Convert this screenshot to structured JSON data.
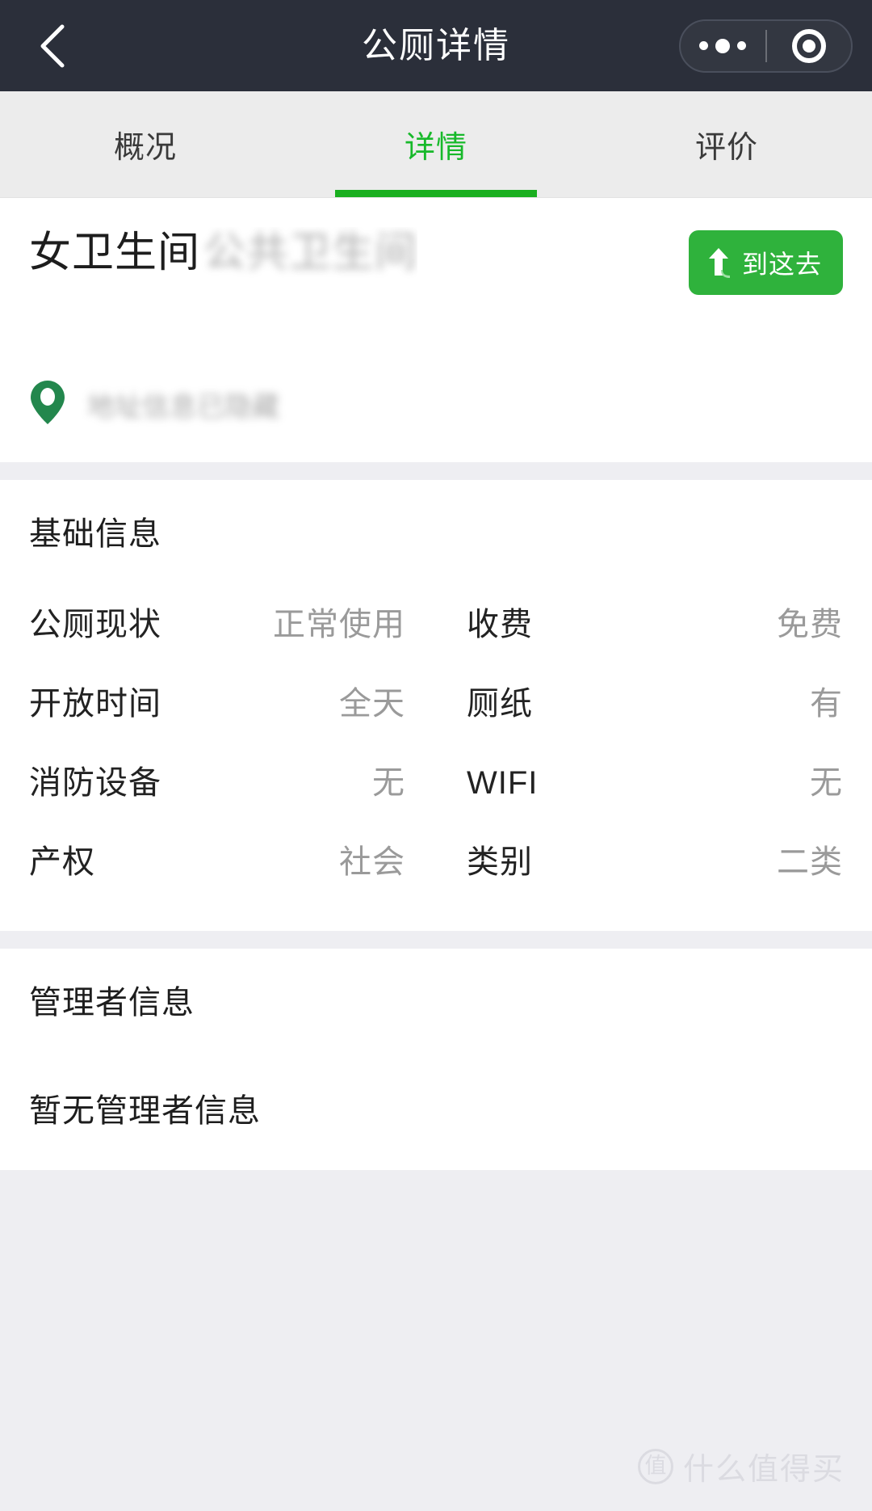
{
  "navbar": {
    "title": "公厕详情",
    "back_icon": "chevron-left-icon",
    "menu_icon": "more-dots-icon",
    "capsule_icon": "target-circle-icon",
    "background": "#2b2f3a"
  },
  "tabs": [
    {
      "label": "概况",
      "active": false
    },
    {
      "label": "详情",
      "active": true
    },
    {
      "label": "评价",
      "active": false
    }
  ],
  "poi": {
    "name": "女卫生间",
    "name_redacted": "公共卫生间",
    "address": "地址信息已隐藏",
    "pin_icon": "map-pin-icon",
    "nav_button": {
      "label": "到这去",
      "icon": "navigate-arrow-icon",
      "color": "#2fb23c"
    }
  },
  "basic_info": {
    "section_title": "基础信息",
    "rows": [
      {
        "left_label": "公厕现状",
        "left_value": "正常使用",
        "right_label": "收费",
        "right_value": "免费"
      },
      {
        "left_label": "开放时间",
        "left_value": "全天",
        "right_label": "厕纸",
        "right_value": "有"
      },
      {
        "left_label": "消防设备",
        "left_value": "无",
        "right_label": "WIFI",
        "right_value": "无"
      },
      {
        "left_label": "产权",
        "left_value": "社会",
        "right_label": "类别",
        "right_value": "二类"
      }
    ]
  },
  "manager_info": {
    "section_title": "管理者信息",
    "empty_text": "暂无管理者信息"
  },
  "watermark": {
    "badge": "值",
    "text": "什么值得买"
  },
  "theme": {
    "accent_green": "#1aaf1f",
    "button_green": "#2fb23c",
    "nav_dark": "#2b2f3a",
    "page_bg": "#eeeef2",
    "tab_bg": "#ececec",
    "value_gray": "#9a9a9a"
  }
}
